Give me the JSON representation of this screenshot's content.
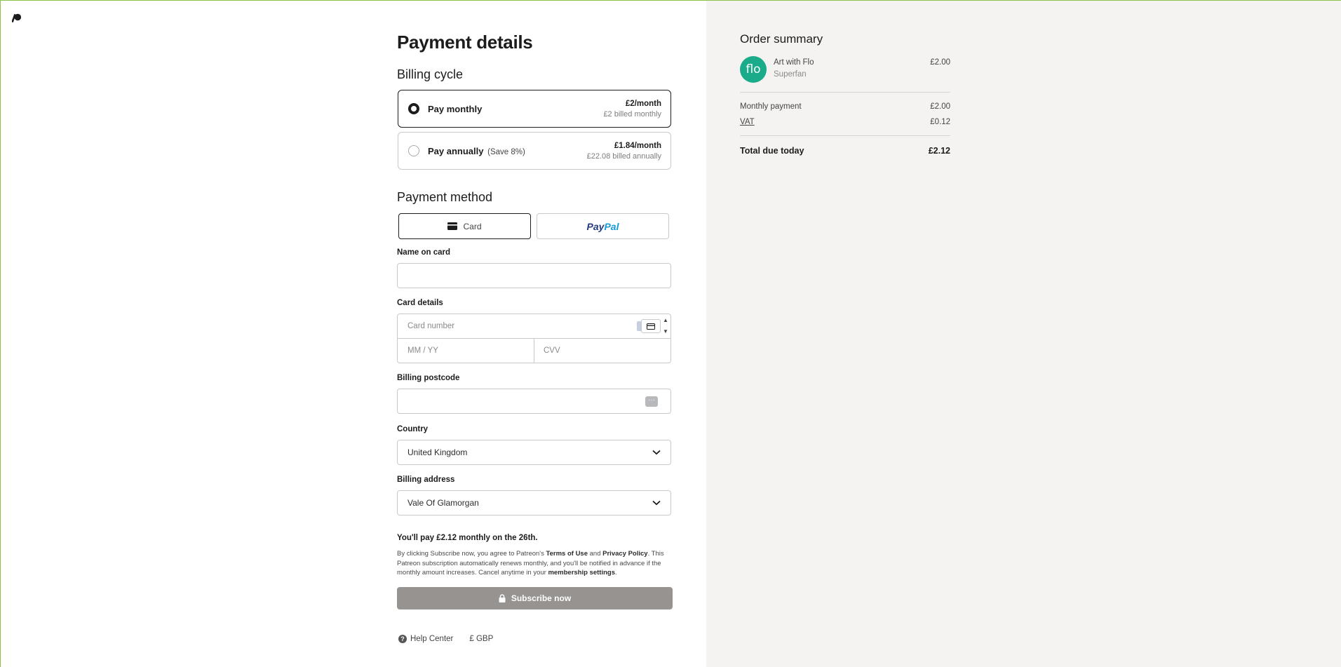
{
  "page": {
    "title": "Payment details",
    "logo": "patreon-logo"
  },
  "billing": {
    "title": "Billing cycle",
    "options": [
      {
        "label": "Pay monthly",
        "extra": "",
        "price": "£2/month",
        "billed": "£2 billed monthly",
        "selected": true
      },
      {
        "label": "Pay annually",
        "extra": "(Save 8%)",
        "price": "£1.84/month",
        "billed": "£22.08 billed annually",
        "selected": false
      }
    ]
  },
  "payment_method": {
    "title": "Payment method",
    "card_label": "Card",
    "paypal_pay": "Pay",
    "paypal_pal": "Pal"
  },
  "fields": {
    "name_on_card_label": "Name on card",
    "card_details_label": "Card details",
    "card_number_placeholder": "Card number",
    "expiry_placeholder": "MM / YY",
    "cvv_placeholder": "CVV",
    "postcode_label": "Billing postcode",
    "country_label": "Country",
    "country_value": "United Kingdom",
    "address_label": "Billing address",
    "address_value": "Vale Of Glamorgan"
  },
  "confirm": {
    "pay_summary": "You'll pay £2.12 monthly on the 26th.",
    "legal_1": "By clicking Subscribe now, you agree to Patreon's ",
    "terms": "Terms of Use",
    "and": " and ",
    "privacy": "Privacy Policy",
    "legal_2": ". This Patreon subscription automatically renews monthly, and you'll be notified in advance if the monthly amount increases. Cancel anytime in your ",
    "membership": "membership settings",
    "legal_3": ".",
    "subscribe_label": "Subscribe now"
  },
  "footer": {
    "help": "Help Center",
    "currency": "£ GBP"
  },
  "summary": {
    "title": "Order summary",
    "avatar_text": "flo",
    "creator": "Art with Flo",
    "tier": "Superfan",
    "tier_price": "£2.00",
    "monthly_label": "Monthly payment",
    "monthly_value": "£2.00",
    "vat_label": "VAT",
    "vat_value": "£0.12",
    "total_label": "Total due today",
    "total_value": "£2.12"
  },
  "colors": {
    "avatar": "#1aab8a",
    "subscribe_disabled": "#979390",
    "summary_bg": "#f4f3f1",
    "paypal_dark": "#253b80",
    "paypal_light": "#179bd7"
  }
}
